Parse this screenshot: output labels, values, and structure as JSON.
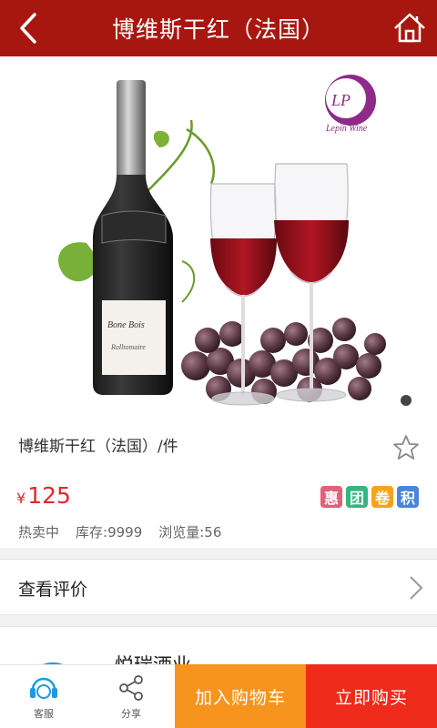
{
  "header": {
    "title": "博维斯干红（法国）"
  },
  "banner": {
    "brand_logo_text": "LP",
    "brand_logo_subtext": "Lepin Wine"
  },
  "product": {
    "name": "博维斯干红（法国）/件",
    "currency": "¥",
    "price": "125",
    "tags": [
      {
        "label": "惠",
        "color": "#e45f7a"
      },
      {
        "label": "团",
        "color": "#35b57f"
      },
      {
        "label": "卷",
        "color": "#f7a21b"
      },
      {
        "label": "积",
        "color": "#4a86d9"
      }
    ],
    "status": "热卖中",
    "stock": "库存:9999",
    "views": "浏览量:56"
  },
  "reviews": {
    "label": "查看评价"
  },
  "store": {
    "name": "悦瑞酒业"
  },
  "bottom_bar": {
    "service_label": "客服",
    "share_label": "分享",
    "cart_label": "加入购物车",
    "buy_label": "立即购买"
  },
  "colors": {
    "header": "#a8170f",
    "price": "#e8262b",
    "cart": "#f7941d",
    "buy": "#ef2b1c"
  }
}
